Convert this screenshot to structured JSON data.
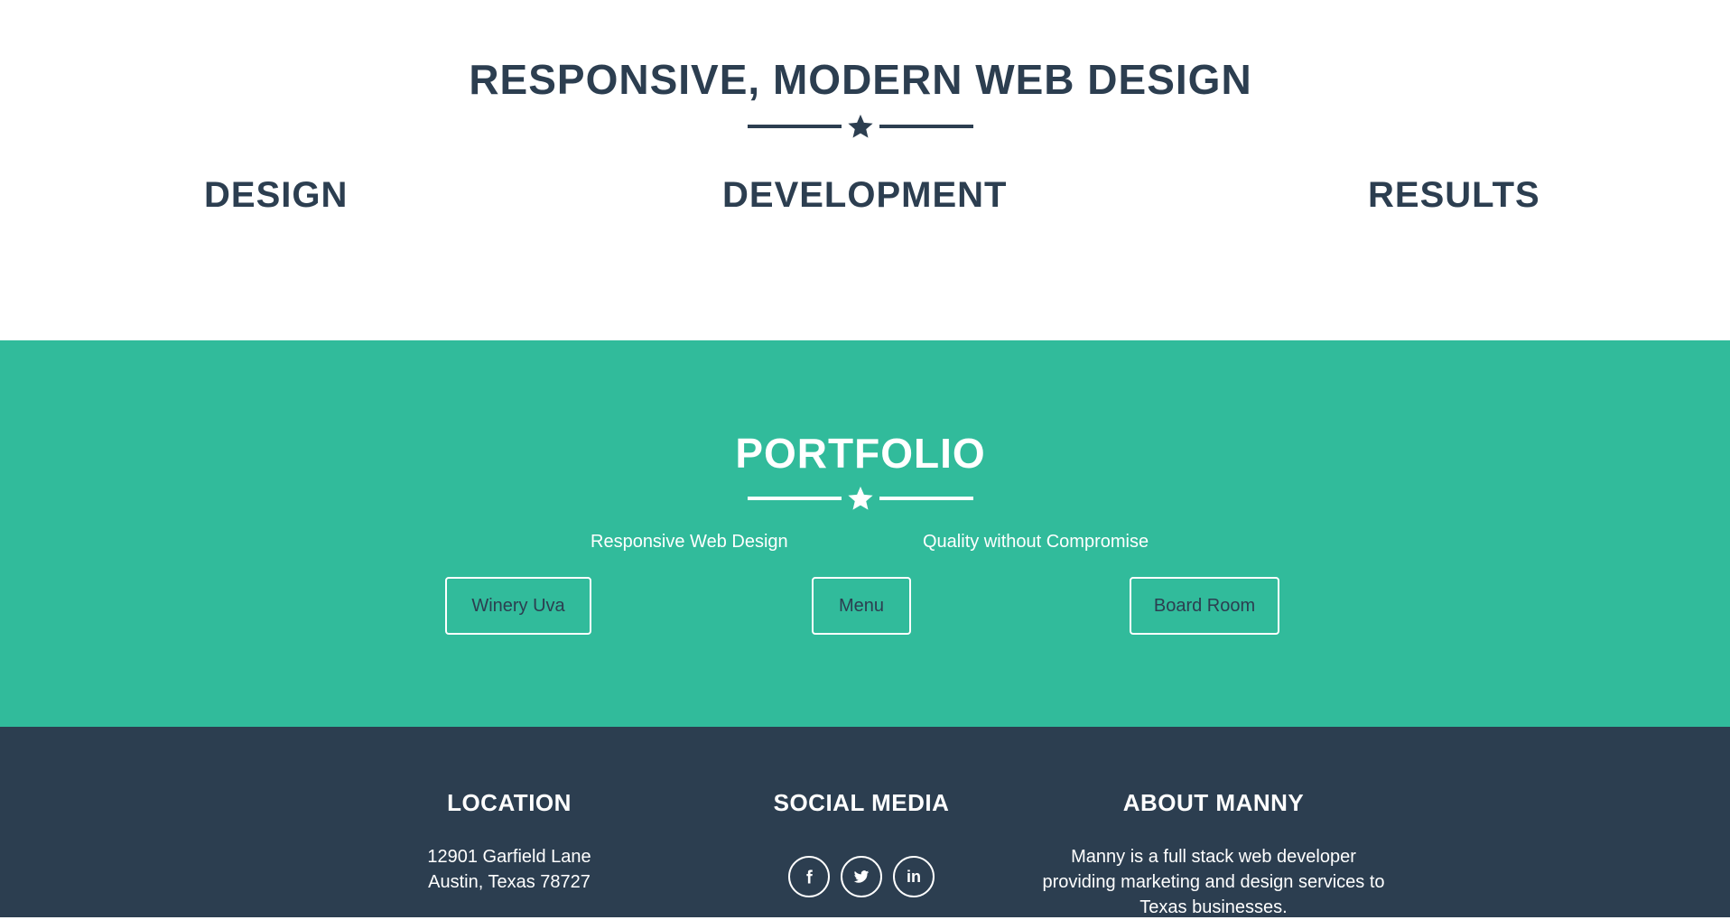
{
  "about": {
    "title": "RESPONSIVE, MODERN WEB DESIGN",
    "columns": [
      "DESIGN",
      "DEVELOPMENT",
      "RESULTS"
    ]
  },
  "portfolio": {
    "title": "PORTFOLIO",
    "taglines": [
      "Responsive Web Design",
      "Quality without Compromise"
    ],
    "buttons": [
      "Winery Uva",
      "Menu",
      "Board Room"
    ]
  },
  "footer": {
    "location": {
      "heading": "LOCATION",
      "address_line1": "12901 Garfield Lane",
      "address_line2": "Austin, Texas 78727"
    },
    "social": {
      "heading": "SOCIAL MEDIA",
      "links": [
        {
          "icon": "facebook-icon"
        },
        {
          "icon": "twitter-icon"
        },
        {
          "icon": "linkedin-icon",
          "label": "in"
        }
      ]
    },
    "about": {
      "heading": "ABOUT MANNY",
      "text": "Manny is a full stack web developer providing marketing and design services to Texas businesses."
    }
  },
  "colors": {
    "navy": "#2c3e50",
    "teal": "#31bb9b",
    "white": "#ffffff"
  }
}
